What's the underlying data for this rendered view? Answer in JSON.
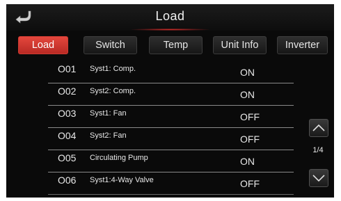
{
  "header": {
    "title": "Load"
  },
  "tabs": [
    {
      "label": "Load",
      "active": true
    },
    {
      "label": "Switch",
      "active": false
    },
    {
      "label": "Temp",
      "active": false
    },
    {
      "label": "Unit Info",
      "active": false
    },
    {
      "label": "Inverter",
      "active": false
    }
  ],
  "rows": [
    {
      "code": "O01",
      "name": "Syst1: Comp.",
      "state": "ON"
    },
    {
      "code": "O02",
      "name": "Syst2: Comp.",
      "state": "ON"
    },
    {
      "code": "O03",
      "name": "Syst1: Fan",
      "state": "OFF"
    },
    {
      "code": "O04",
      "name": "Syst2: Fan",
      "state": "OFF"
    },
    {
      "code": "O05",
      "name": "Circulating Pump",
      "state": "ON"
    },
    {
      "code": "O06",
      "name": "Syst1:4-Way Valve",
      "state": "OFF"
    }
  ],
  "pagination": {
    "indicator": "1/4"
  },
  "icons": {
    "back": "back-arrow-icon",
    "up": "chevron-up-icon",
    "down": "chevron-down-icon"
  },
  "colors": {
    "accent": "#d9362f",
    "background": "#0a0a0a",
    "text": "#e8e8e8"
  }
}
